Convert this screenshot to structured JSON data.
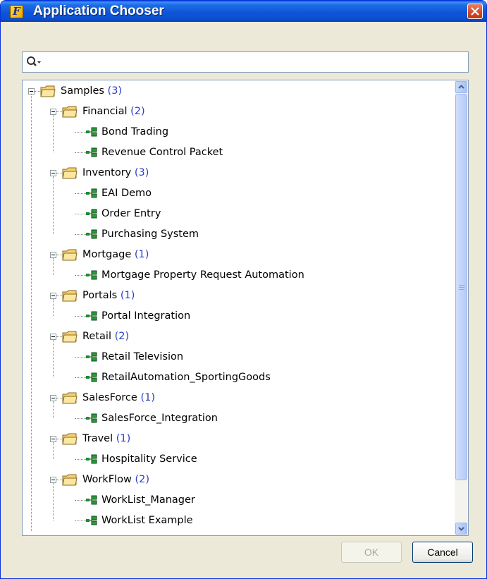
{
  "window": {
    "title": "Application Chooser",
    "app_icon_letter": "F"
  },
  "search": {
    "value": "",
    "placeholder": ""
  },
  "tree": {
    "root": {
      "label": "Samples",
      "count": "(3)",
      "expanded": true
    },
    "groups": [
      {
        "label": "Financial",
        "count": "(2)",
        "items": [
          "Bond Trading",
          "Revenue Control Packet"
        ]
      },
      {
        "label": "Inventory",
        "count": "(3)",
        "items": [
          "EAI Demo",
          "Order Entry",
          "Purchasing System"
        ]
      },
      {
        "label": "Mortgage",
        "count": "(1)",
        "items": [
          "Mortgage Property Request Automation"
        ]
      },
      {
        "label": "Portals",
        "count": "(1)",
        "items": [
          "Portal Integration"
        ]
      },
      {
        "label": "Retail",
        "count": "(2)",
        "items": [
          "Retail Television",
          "RetailAutomation_SportingGoods"
        ]
      },
      {
        "label": "SalesForce",
        "count": "(1)",
        "items": [
          "SalesForce_Integration"
        ]
      },
      {
        "label": "Travel",
        "count": "(1)",
        "items": [
          "Hospitality Service"
        ]
      },
      {
        "label": "WorkFlow",
        "count": "(2)",
        "items": [
          "WorkList_Manager",
          "WorkList Example"
        ]
      }
    ]
  },
  "buttons": {
    "ok": {
      "label": "OK",
      "enabled": false
    },
    "cancel": {
      "label": "Cancel",
      "enabled": true
    }
  },
  "colors": {
    "titlebar": "#0d56d8",
    "count_text": "#2a3fc8",
    "dialog_bg": "#ece9d8"
  }
}
